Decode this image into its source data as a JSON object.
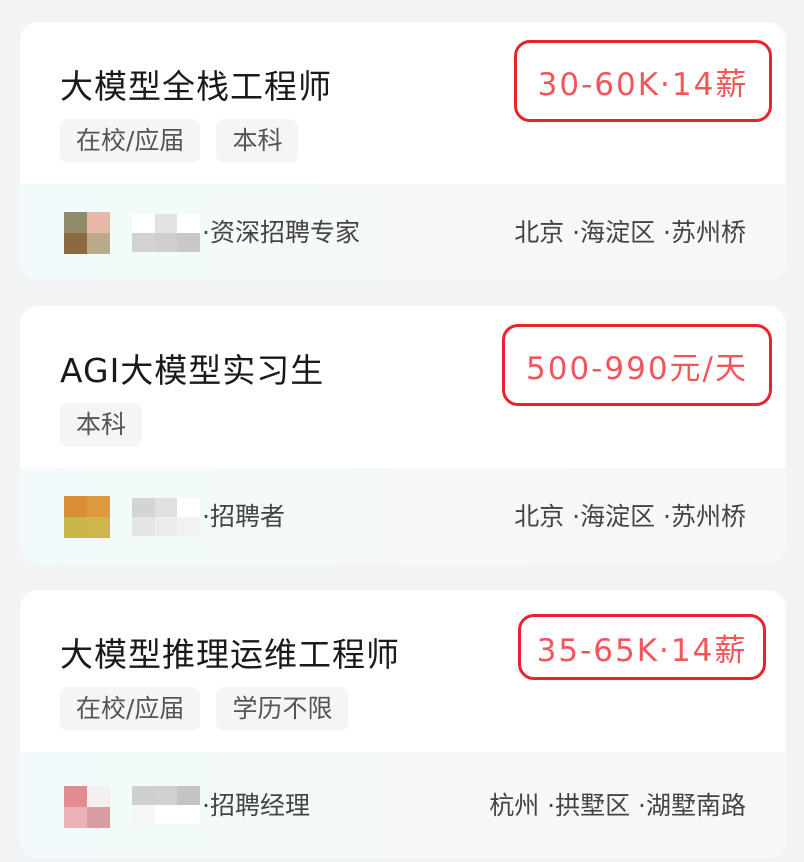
{
  "jobs": [
    {
      "title": "大模型全栈工程师",
      "salary": "30-60K·14薪",
      "tags": [
        "在校/应届",
        "本科"
      ],
      "recruiter": "·资深招聘专家",
      "location": "北京 ·海淀区 ·苏州桥",
      "avatar_colors": [
        "#8f8a6a",
        "#e8b7a8",
        "#8a6a3e",
        "#b8aa8a"
      ],
      "name_blur_colors": [
        "#ffffff",
        "#e2e2e2",
        "#ffffff",
        "#d2d2d2",
        "#cfcfcf",
        "#c8c8c8"
      ]
    },
    {
      "title": "AGI大模型实习生",
      "salary": "500-990元/天",
      "tags": [
        "本科"
      ],
      "recruiter": "·招聘者",
      "location": "北京 ·海淀区 ·苏州桥",
      "avatar_colors": [
        "#d98d35",
        "#dd9a3e",
        "#c9b648",
        "#cfb649"
      ],
      "name_blur_colors": [
        "#d4d4d4",
        "#e0e0e0",
        "#ffffff",
        "#e6e6e6",
        "#ececec",
        "#f2f2f2"
      ]
    },
    {
      "title": "大模型推理运维工程师",
      "salary": "35-65K·14薪",
      "tags": [
        "在校/应届",
        "学历不限"
      ],
      "recruiter": "·招聘经理",
      "location": "杭州 ·拱墅区 ·湖墅南路",
      "avatar_colors": [
        "#e38a92",
        "#f4f0f0",
        "#eab2b6",
        "#d99ea3"
      ],
      "name_blur_colors": [
        "#cfcfcf",
        "#d0d0d0",
        "#c4c4c4",
        "#f7f7f7",
        "#ffffff",
        "#ffffff"
      ]
    }
  ]
}
